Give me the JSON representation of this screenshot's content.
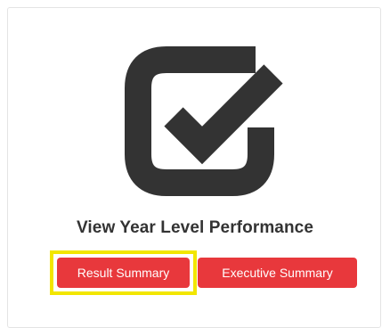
{
  "panel": {
    "title": "View Year Level Performance",
    "icon": "checkbox-check-icon",
    "icon_color": "#333333"
  },
  "buttons": {
    "result_summary": "Result Summary",
    "executive_summary": "Executive Summary",
    "color": "#e8383c",
    "highlight_color": "#f2e600"
  }
}
